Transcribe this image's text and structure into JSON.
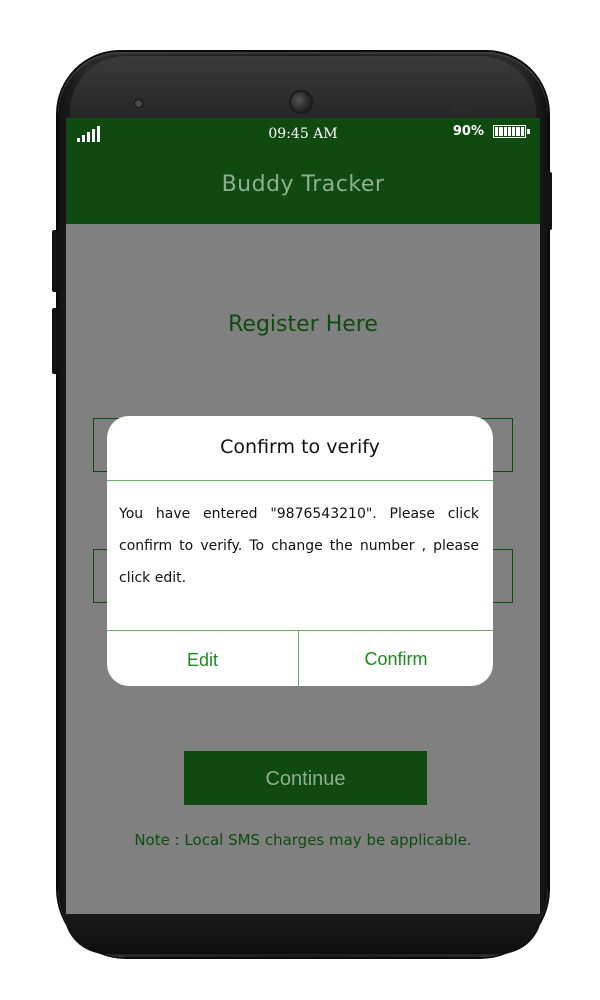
{
  "status_bar": {
    "time": "09:45 AM",
    "battery_percent": "90%",
    "battery_level": 0.9,
    "signal_icon": "signal-bars-icon",
    "battery_icon": "battery-icon"
  },
  "app_bar": {
    "title": "Buddy Tracker"
  },
  "main": {
    "heading": "Register Here",
    "continue_label": "Continue",
    "note": "Note : Local SMS charges may be applicable."
  },
  "dialog": {
    "title": "Confirm to verify",
    "message": "You have entered \"9876543210\". Please click confirm to verify. To change the number , please click edit.",
    "edit_label": "Edit",
    "confirm_label": "Confirm"
  },
  "colors": {
    "primary_dark_green": "#104a10",
    "muted_green_text": "#8fae8f",
    "dialog_accent_green": "#1e8a1e",
    "screen_dim_gray": "#808080"
  }
}
